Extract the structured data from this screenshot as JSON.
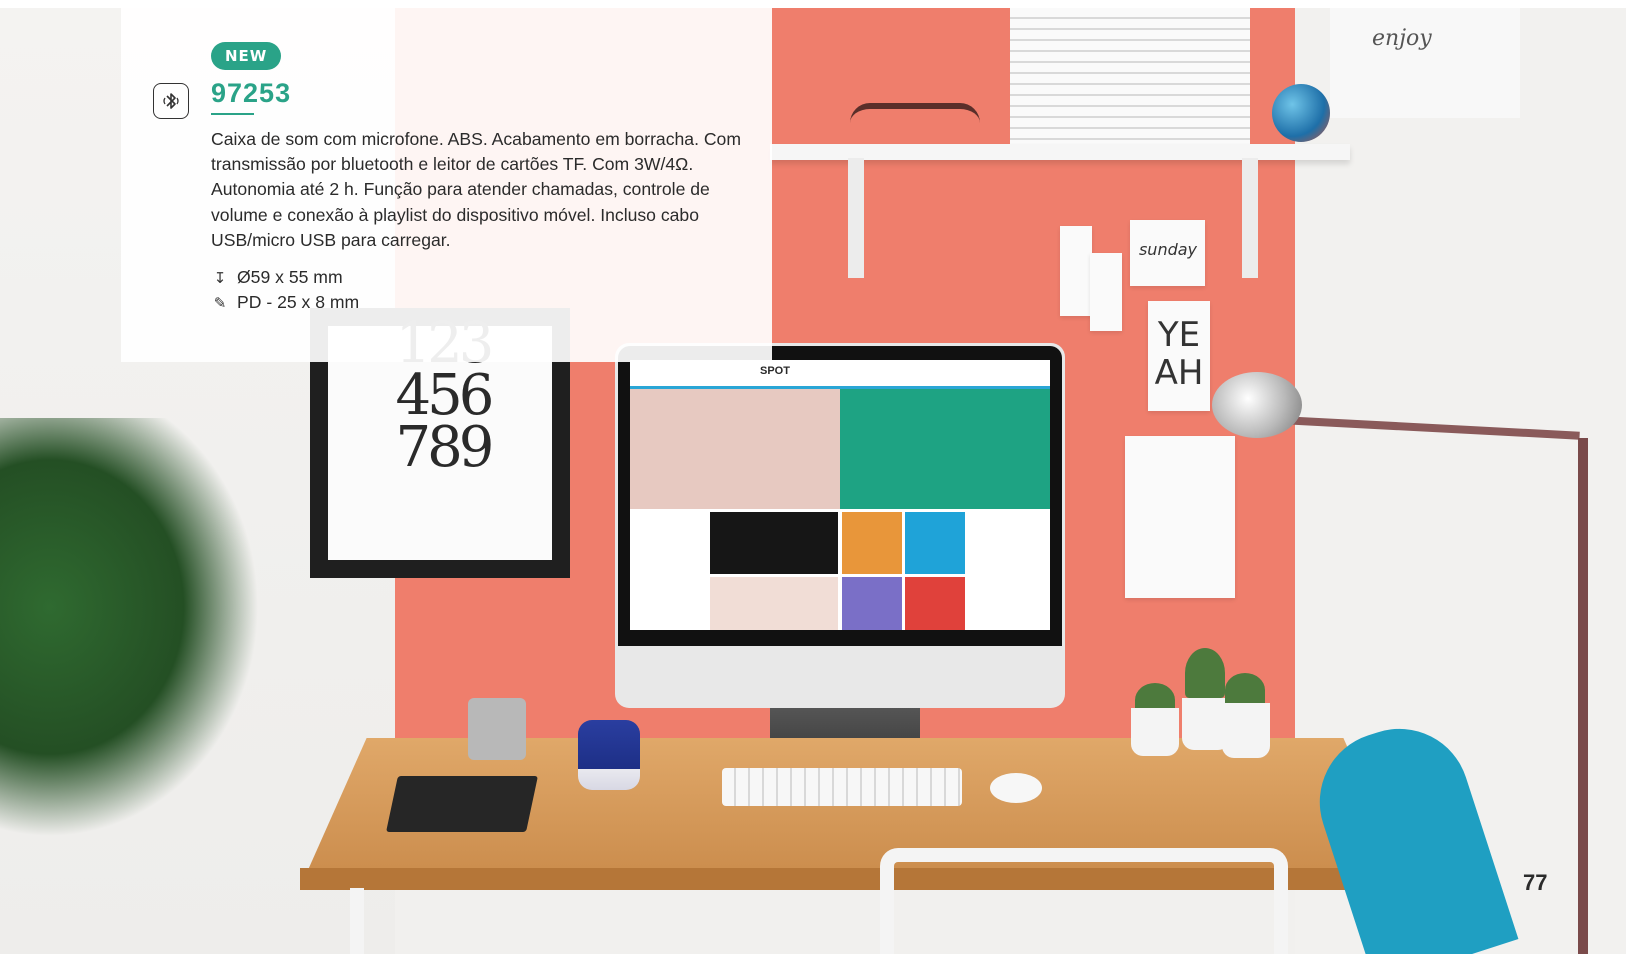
{
  "badge": {
    "label": "NEW"
  },
  "product": {
    "code": "97253",
    "description": "Caixa de som com microfone. ABS. Acabamento em borracha. Com transmissão por bluetooth e leitor de cartões TF. Com 3W/4Ω. Autonomia até 2 h. Função para atender chamadas, controle de volume e conexão à playlist do dispositivo móvel. Incluso cabo USB/micro USB para carregar.",
    "feature_icon": "bluetooth-icon"
  },
  "specs": [
    {
      "icon": "dimensions-icon",
      "text": "Ø59 x 55 mm"
    },
    {
      "icon": "print-method-icon",
      "text": "PD - 25 x 8 mm"
    }
  ],
  "photo": {
    "poster_digits": [
      "123",
      "456",
      "789"
    ],
    "poster_word": "sunday",
    "poster_yeah": [
      "YE",
      "AH"
    ],
    "enjoy_text": "enjoy",
    "screen_logo": "SPOT"
  },
  "page": {
    "number": "77"
  },
  "colors": {
    "accent": "#2aa388",
    "wall": "#ef7e6c",
    "text": "#2b2b2b"
  }
}
